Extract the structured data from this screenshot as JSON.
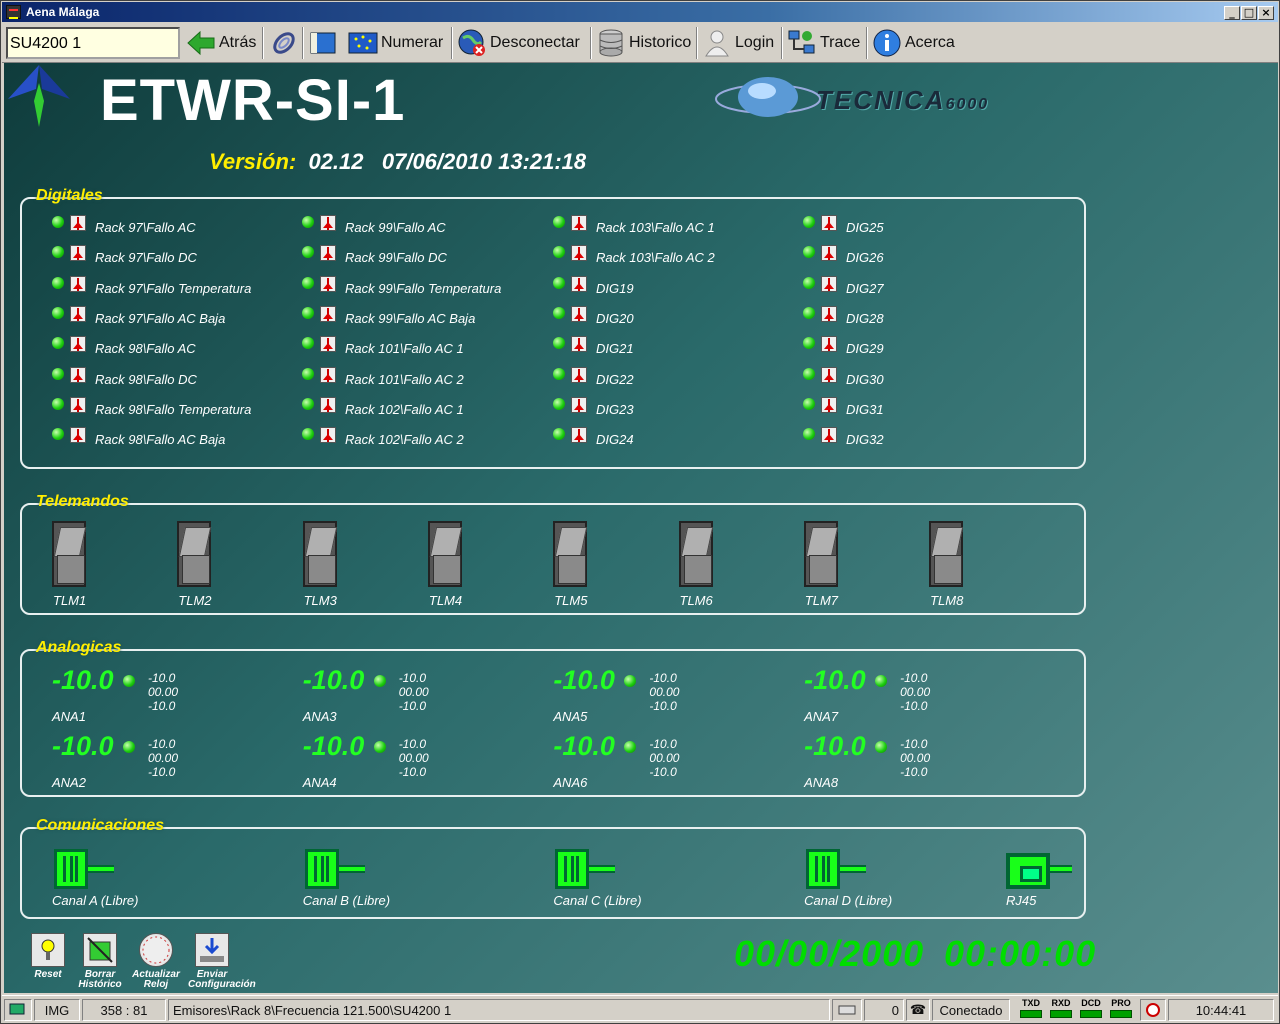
{
  "window": {
    "title": "Aena Málaga"
  },
  "toolbar": {
    "combo_value": "SU4200 1",
    "back": "Atrás",
    "numerar": "Numerar",
    "disconnect": "Desconectar",
    "history": "Historico",
    "login": "Login",
    "trace": "Trace",
    "about": "Acerca"
  },
  "header": {
    "title": "ETWR-SI-1",
    "version_label": "Versión:",
    "version": "02.12",
    "date": "07/06/2010 13:21:18",
    "brand": "TECNICA",
    "brand_num": "6000"
  },
  "digitales": {
    "title": "Digitales",
    "items": [
      "Rack 97\\Fallo AC",
      "Rack 97\\Fallo DC",
      "Rack 97\\Fallo Temperatura",
      "Rack 97\\Fallo AC Baja",
      "Rack 98\\Fallo AC",
      "Rack 98\\Fallo DC",
      "Rack 98\\Fallo Temperatura",
      "Rack 98\\Fallo AC Baja",
      "Rack 99\\Fallo AC",
      "Rack 99\\Fallo DC",
      "Rack 99\\Fallo Temperatura",
      "Rack 99\\Fallo AC Baja",
      "Rack 101\\Fallo AC 1",
      "Rack 101\\Fallo AC 2",
      "Rack 102\\Fallo AC 1",
      "Rack 102\\Fallo AC 2",
      "Rack 103\\Fallo AC 1",
      "Rack 103\\Fallo AC 2",
      "DIG19",
      "DIG20",
      "DIG21",
      "DIG22",
      "DIG23",
      "DIG24",
      "DIG25",
      "DIG26",
      "DIG27",
      "DIG28",
      "DIG29",
      "DIG30",
      "DIG31",
      "DIG32"
    ]
  },
  "telemandos": {
    "title": "Telemandos",
    "items": [
      "TLM1",
      "TLM2",
      "TLM3",
      "TLM4",
      "TLM5",
      "TLM6",
      "TLM7",
      "TLM8"
    ]
  },
  "analogicas": {
    "title": "Analogicas",
    "items": [
      {
        "name": "ANA1",
        "value": "-10.0",
        "a": "-10.0",
        "b": "00.00",
        "c": "-10.0"
      },
      {
        "name": "ANA2",
        "value": "-10.0",
        "a": "-10.0",
        "b": "00.00",
        "c": "-10.0"
      },
      {
        "name": "ANA3",
        "value": "-10.0",
        "a": "-10.0",
        "b": "00.00",
        "c": "-10.0"
      },
      {
        "name": "ANA4",
        "value": "-10.0",
        "a": "-10.0",
        "b": "00.00",
        "c": "-10.0"
      },
      {
        "name": "ANA5",
        "value": "-10.0",
        "a": "-10.0",
        "b": "00.00",
        "c": "-10.0"
      },
      {
        "name": "ANA6",
        "value": "-10.0",
        "a": "-10.0",
        "b": "00.00",
        "c": "-10.0"
      },
      {
        "name": "ANA7",
        "value": "-10.0",
        "a": "-10.0",
        "b": "00.00",
        "c": "-10.0"
      },
      {
        "name": "ANA8",
        "value": "-10.0",
        "a": "-10.0",
        "b": "00.00",
        "c": "-10.0"
      }
    ]
  },
  "comunicaciones": {
    "title": "Comunicaciones",
    "channels": [
      "Canal A (Libre)",
      "Canal B (Libre)",
      "Canal C (Libre)",
      "Canal D (Libre)"
    ],
    "rj45": "RJ45"
  },
  "actions": {
    "reset": "Reset",
    "borrar1": "Borrar",
    "borrar2": "Histórico",
    "actualizar1": "Actualizar",
    "actualizar2": "Reloj",
    "enviar1": "Enviar",
    "enviar2": "Configuración"
  },
  "clock": {
    "date": "00/00/2000",
    "time": "00:00:00"
  },
  "status": {
    "img": "IMG",
    "coords": "358 : 81",
    "path": "Emisores\\Rack 8\\Frecuencia 121.500\\SU4200 1",
    "count": "0",
    "state": "Conectado",
    "txd": "TXD",
    "rxd": "RXD",
    "dcd": "DCD",
    "pro": "PRO",
    "time": "10:44:41"
  },
  "colors": {
    "accent": "#ffee00",
    "ok": "#22ff22",
    "bg": "#2a6a6a"
  }
}
